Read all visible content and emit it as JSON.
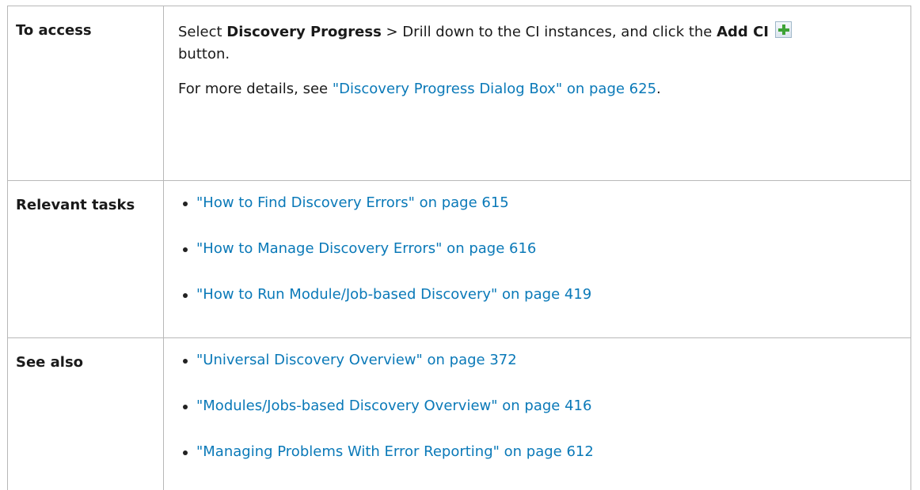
{
  "rows": {
    "access": {
      "header": "To access",
      "line1_pre": "Select ",
      "line1_bold1": "Discovery Progress",
      "line1_mid": " > Drill down to the CI instances, and click the ",
      "line1_bold2": "Add CI",
      "line1_post": "button.",
      "line2_pre": "For more details, see ",
      "line2_link": "\"Discovery Progress Dialog Box\" on page 625",
      "line2_post": ".",
      "icon": "add-ci-plus-icon",
      "icon_color": "#3ea336"
    },
    "tasks": {
      "header": "Relevant tasks",
      "items": [
        "\"How to Find Discovery Errors\" on page 615",
        "\"How to Manage Discovery Errors\" on page 616",
        "\"How to Run Module/Job-based Discovery\" on page 419"
      ]
    },
    "see_also": {
      "header": "See also",
      "items": [
        "\"Universal Discovery Overview\" on page 372",
        "\"Modules/Jobs-based Discovery Overview\" on page 416",
        "\"Managing Problems With Error Reporting\" on page 612"
      ]
    }
  },
  "colors": {
    "link": "#0a79b8",
    "border": "#b8b8b8",
    "text": "#1a1a1a"
  }
}
